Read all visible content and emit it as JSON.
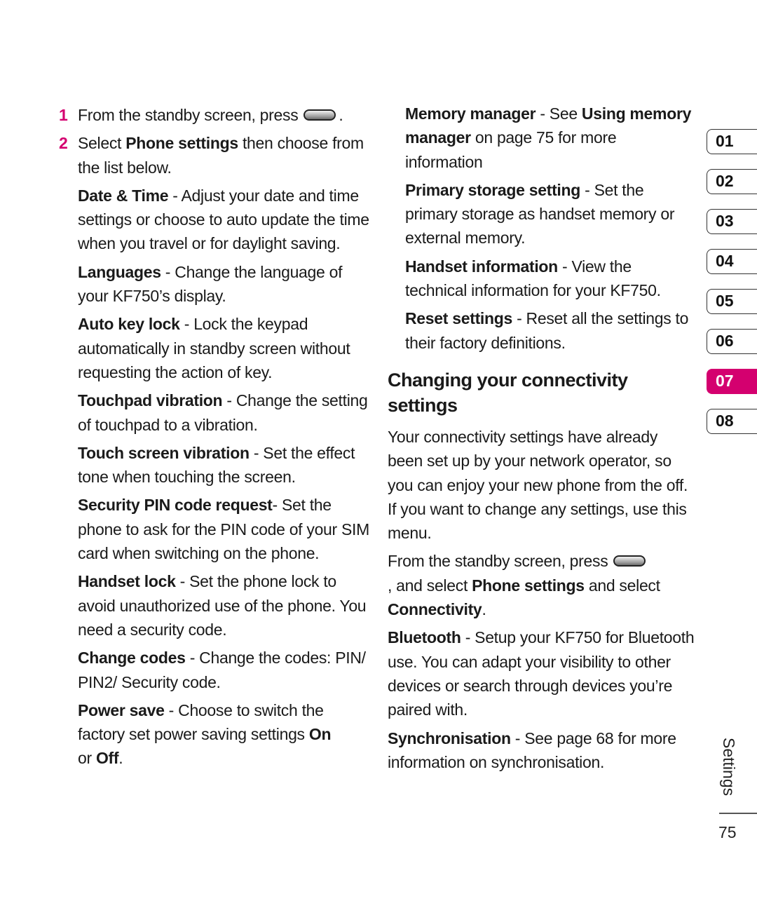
{
  "colors": {
    "accent": "#d4006f"
  },
  "steps": [
    {
      "num": "1",
      "before": "From the standby screen, press",
      "icon": "menu-key-icon",
      "after": "."
    },
    {
      "num": "2",
      "pre": "Select ",
      "bold": "Phone settings",
      "post": " then choose from the list below."
    }
  ],
  "left_entries": [
    {
      "term": "Date & Time",
      "desc": " - Adjust your date and time settings or choose to auto update the time when you travel or for daylight saving."
    },
    {
      "term": "Languages",
      "desc": " - Change the language of your KF750’s display."
    },
    {
      "term": "Auto key lock",
      "desc": " - Lock the keypad automatically in standby screen without requesting the action of key."
    },
    {
      "term": "Touchpad vibration",
      "desc": " - Change the setting of touchpad to a vibration."
    },
    {
      "term": "Touch screen vibration",
      "desc": " - Set the effect tone when touching the screen."
    },
    {
      "term": "Security PIN code request",
      "desc": "- Set the phone to ask for the PIN code of your SIM card when switching on the phone."
    },
    {
      "term": "Handset lock",
      "desc": " - Set the phone lock to avoid unauthorized use of the phone. You need a security code."
    },
    {
      "term": "Change codes",
      "desc": " - Change the codes: PIN/ PIN2/ Security code."
    },
    {
      "term": "Power save",
      "desc": " - Choose to switch the factory set power saving settings ",
      "on": "On",
      "mid": " or ",
      "off": "Off",
      "end": "."
    }
  ],
  "right_entries": [
    {
      "term": "Memory manager",
      "desc": " - See ",
      "link": "Using memory manager",
      "desc2": " on page 75 for more information"
    },
    {
      "term": "Primary storage setting",
      "desc": " - Set the primary storage as handset memory or external memory."
    },
    {
      "term": "Handset information",
      "desc": " - View the technical information for your KF750."
    },
    {
      "term": "Reset settings",
      "desc": " - Reset all the settings to their factory definitions."
    }
  ],
  "connectivity": {
    "title": "Changing your connectivity settings",
    "intro": "Your connectivity settings have already been set up by your network operator, so you can enjoy your new phone from the off. If you want to change any settings, use this menu.",
    "instr_before": "From the standby screen, press",
    "instr_mid": ", and select ",
    "instr_bold1": "Phone settings",
    "instr_mid2": " and select ",
    "instr_bold2": "Connectivity",
    "instr_end": ".",
    "entries": [
      {
        "term": "Bluetooth",
        "desc": " - Setup your KF750 for Bluetooth use. You can adapt your visibility to other devices or search through devices you’re paired with."
      },
      {
        "term": "Synchronisation",
        "desc": " - See page 68 for more information on synchronisation."
      }
    ]
  },
  "chapter_tabs": [
    {
      "label": "01",
      "active": false
    },
    {
      "label": "02",
      "active": false
    },
    {
      "label": "03",
      "active": false
    },
    {
      "label": "04",
      "active": false
    },
    {
      "label": "05",
      "active": false
    },
    {
      "label": "06",
      "active": false
    },
    {
      "label": "07",
      "active": true
    },
    {
      "label": "08",
      "active": false
    }
  ],
  "section_label": "Settings",
  "page_number": "75"
}
